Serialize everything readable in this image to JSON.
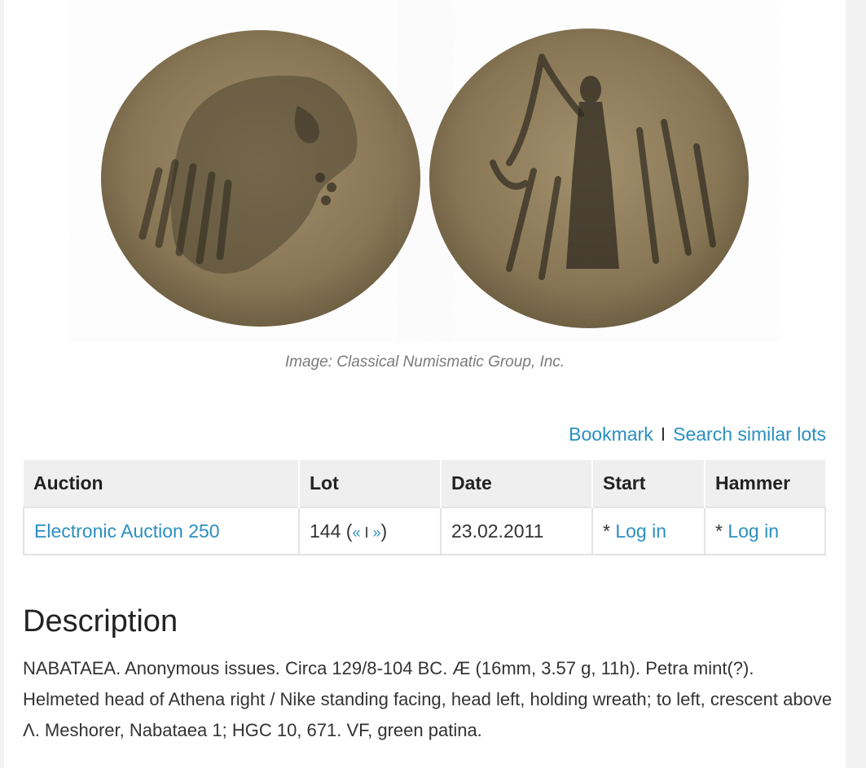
{
  "image": {
    "caption": "Image: Classical Numismatic Group, Inc.",
    "obverse_alt": "Helmeted head of Athena right",
    "reverse_alt": "Nike standing facing, holding wreath",
    "coin_color": "#8c7a58"
  },
  "actions": {
    "bookmark_label": "Bookmark",
    "separator": "I",
    "search_similar_label": "Search similar lots"
  },
  "table": {
    "headers": [
      "Auction",
      "Lot",
      "Date",
      "Start",
      "Hammer"
    ],
    "row": {
      "auction": "Electronic Auction 250",
      "lot_number": "144",
      "lot_nav_open": " (",
      "prev_label": "«",
      "nav_separator": " I ",
      "next_label": "»",
      "lot_nav_close": ")",
      "date": "23.02.2011",
      "start_prefix": "* ",
      "start_link": "Log in",
      "hammer_prefix": "* ",
      "hammer_link": "Log in"
    }
  },
  "description": {
    "title": "Description",
    "text": "NABATAEA. Anonymous issues. Circa 129/8-104 BC. Æ (16mm, 3.57 g, 11h). Petra mint(?). Helmeted head of Athena right / Nike standing facing, head left, holding wreath; to left, crescent above Λ. Meshorer, Nabataea 1; HGC 10, 671. VF, green patina."
  },
  "colors": {
    "link": "#2a8fc0",
    "header_bg": "#efefef",
    "border": "#e4e4e4"
  }
}
